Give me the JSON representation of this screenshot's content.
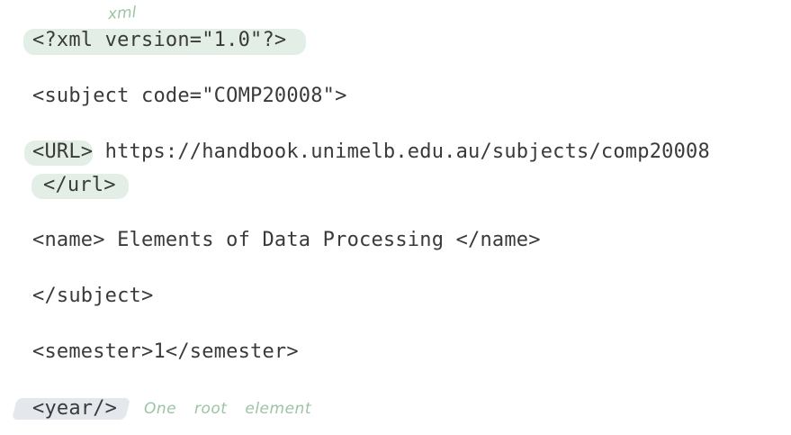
{
  "code_lines": [
    "<?xml version=\"1.0\"?>",
    "<subject code=\"COMP20008\">",
    "<URL> https://handbook.unimelb.edu.au/subjects/comp20008",
    "</url>",
    "<name> Elements of Data Processing </name>",
    "</subject>",
    "<semester>1</semester>",
    "<year/>"
  ],
  "annotations": {
    "xml_note": "xml",
    "root_note": "One root element"
  },
  "colors": {
    "highlight": "#e3efe6",
    "annotation_ink": "#9bc4a4",
    "text": "#3a3a3a"
  }
}
